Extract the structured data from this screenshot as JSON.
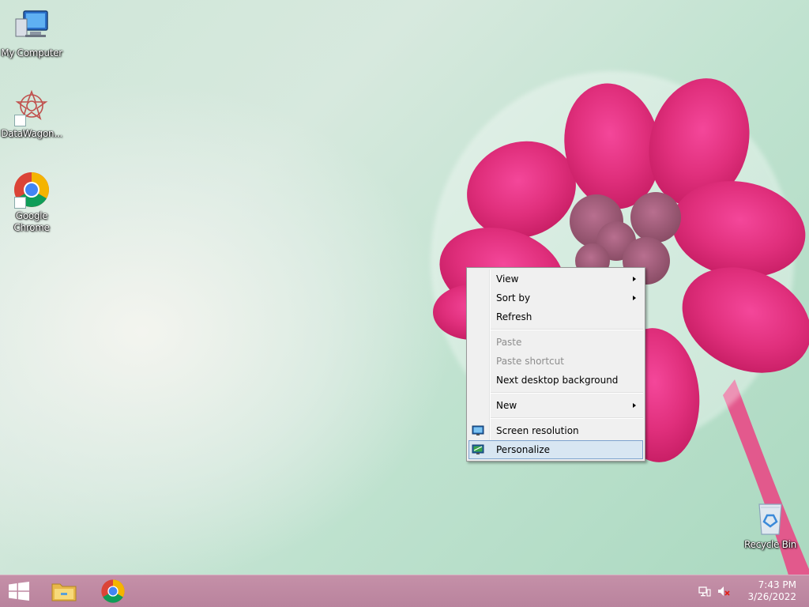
{
  "desktop": {
    "icons": [
      {
        "label": "My Computer",
        "icon": "computer-icon"
      },
      {
        "label": "DataWagon...",
        "icon": "datawagon-icon"
      },
      {
        "label": "Google Chrome",
        "icon": "chrome-icon"
      },
      {
        "label": "Recycle Bin",
        "icon": "recycle-bin-icon"
      }
    ]
  },
  "context_menu": {
    "items": [
      {
        "label": "View",
        "submenu": true,
        "enabled": true
      },
      {
        "label": "Sort by",
        "submenu": true,
        "enabled": true
      },
      {
        "label": "Refresh",
        "enabled": true
      },
      {
        "label": "Paste",
        "enabled": false
      },
      {
        "label": "Paste shortcut",
        "enabled": false
      },
      {
        "label": "Next desktop background",
        "enabled": true
      },
      {
        "label": "New",
        "submenu": true,
        "enabled": true
      },
      {
        "label": "Screen resolution",
        "icon": "monitor-icon",
        "enabled": true
      },
      {
        "label": "Personalize",
        "icon": "personalize-icon",
        "enabled": true,
        "highlighted": true
      }
    ]
  },
  "taskbar": {
    "start_icon": "windows-logo-icon",
    "pinned": [
      {
        "name": "File Explorer",
        "icon": "folder-icon"
      },
      {
        "name": "Google Chrome",
        "icon": "chrome-icon"
      }
    ],
    "tray": {
      "icons": [
        "network-icon",
        "volume-muted-icon"
      ],
      "time": "7:43 PM",
      "date": "3/26/2022"
    }
  },
  "colors": {
    "taskbar": "#bd889f",
    "menu_highlight": "#d8e6f2",
    "flower": "#e2337d"
  }
}
